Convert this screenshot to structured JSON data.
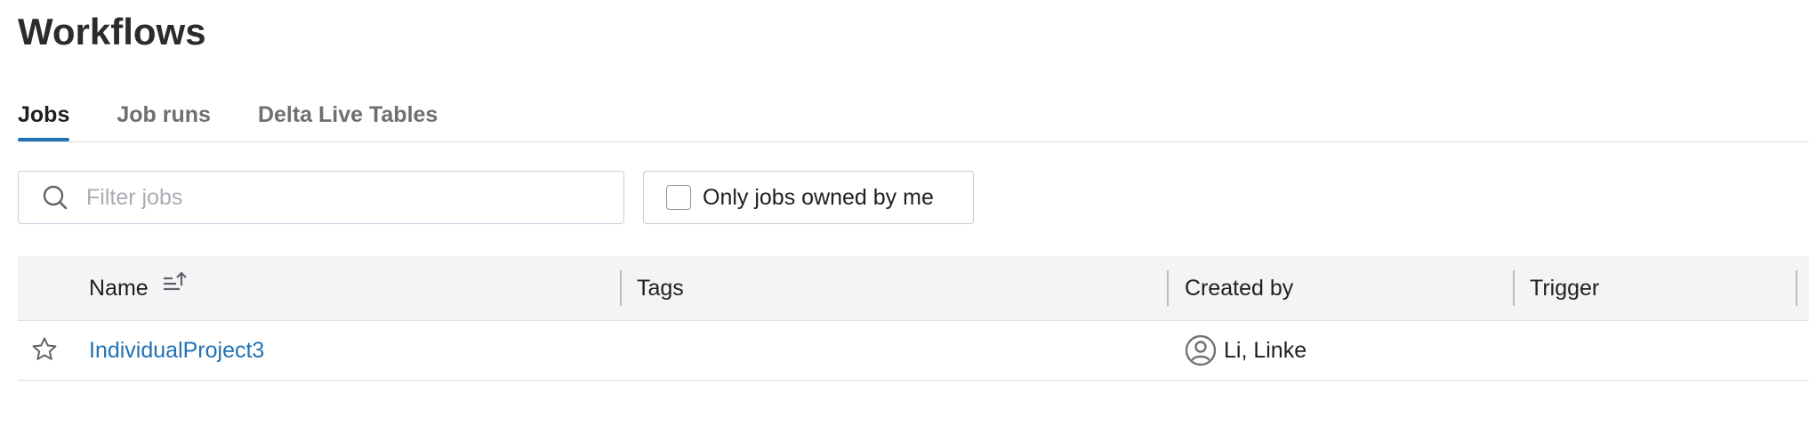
{
  "page": {
    "title": "Workflows"
  },
  "tabs": [
    {
      "label": "Jobs",
      "active": true
    },
    {
      "label": "Job runs",
      "active": false
    },
    {
      "label": "Delta Live Tables",
      "active": false
    }
  ],
  "filter": {
    "search_placeholder": "Filter jobs",
    "search_value": "",
    "search_icon": "search-icon",
    "owned_checkbox_label": "Only jobs owned by me",
    "owned_checked": false
  },
  "table": {
    "columns": [
      {
        "key": "name",
        "label": "Name",
        "sort": "ascending",
        "sort_icon": "sort-ascending-icon"
      },
      {
        "key": "tags",
        "label": "Tags"
      },
      {
        "key": "created_by",
        "label": "Created by"
      },
      {
        "key": "trigger",
        "label": "Trigger"
      }
    ],
    "rows": [
      {
        "favorite": false,
        "favorite_icon": "star-outline-icon",
        "name": "IndividualProject3",
        "tags": "",
        "created_by": "Li, Linke",
        "creator_icon": "user-avatar-icon",
        "trigger": ""
      }
    ]
  },
  "colors": {
    "accent": "#2272b4",
    "header_bg": "#f3f4f6",
    "link": "#2272b4"
  }
}
